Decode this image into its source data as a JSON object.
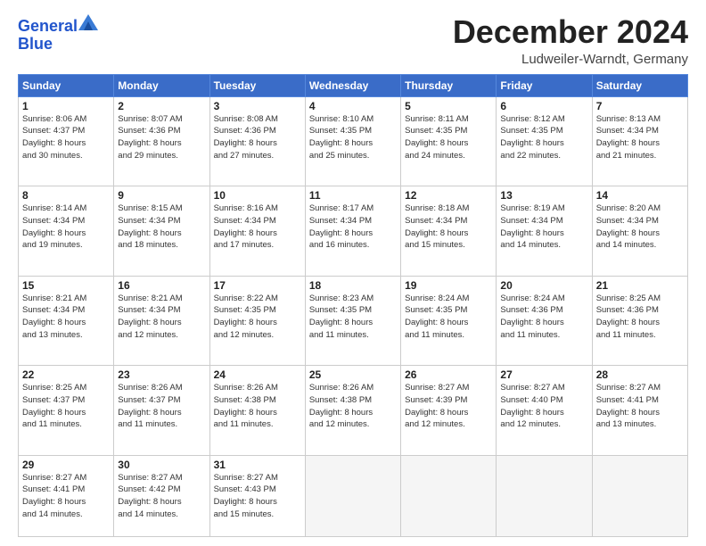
{
  "logo": {
    "line1": "General",
    "line2": "Blue"
  },
  "title": "December 2024",
  "location": "Ludweiler-Warndt, Germany",
  "headers": [
    "Sunday",
    "Monday",
    "Tuesday",
    "Wednesday",
    "Thursday",
    "Friday",
    "Saturday"
  ],
  "weeks": [
    [
      {
        "day": "1",
        "info": "Sunrise: 8:06 AM\nSunset: 4:37 PM\nDaylight: 8 hours\nand 30 minutes."
      },
      {
        "day": "2",
        "info": "Sunrise: 8:07 AM\nSunset: 4:36 PM\nDaylight: 8 hours\nand 29 minutes."
      },
      {
        "day": "3",
        "info": "Sunrise: 8:08 AM\nSunset: 4:36 PM\nDaylight: 8 hours\nand 27 minutes."
      },
      {
        "day": "4",
        "info": "Sunrise: 8:10 AM\nSunset: 4:35 PM\nDaylight: 8 hours\nand 25 minutes."
      },
      {
        "day": "5",
        "info": "Sunrise: 8:11 AM\nSunset: 4:35 PM\nDaylight: 8 hours\nand 24 minutes."
      },
      {
        "day": "6",
        "info": "Sunrise: 8:12 AM\nSunset: 4:35 PM\nDaylight: 8 hours\nand 22 minutes."
      },
      {
        "day": "7",
        "info": "Sunrise: 8:13 AM\nSunset: 4:34 PM\nDaylight: 8 hours\nand 21 minutes."
      }
    ],
    [
      {
        "day": "8",
        "info": "Sunrise: 8:14 AM\nSunset: 4:34 PM\nDaylight: 8 hours\nand 19 minutes."
      },
      {
        "day": "9",
        "info": "Sunrise: 8:15 AM\nSunset: 4:34 PM\nDaylight: 8 hours\nand 18 minutes."
      },
      {
        "day": "10",
        "info": "Sunrise: 8:16 AM\nSunset: 4:34 PM\nDaylight: 8 hours\nand 17 minutes."
      },
      {
        "day": "11",
        "info": "Sunrise: 8:17 AM\nSunset: 4:34 PM\nDaylight: 8 hours\nand 16 minutes."
      },
      {
        "day": "12",
        "info": "Sunrise: 8:18 AM\nSunset: 4:34 PM\nDaylight: 8 hours\nand 15 minutes."
      },
      {
        "day": "13",
        "info": "Sunrise: 8:19 AM\nSunset: 4:34 PM\nDaylight: 8 hours\nand 14 minutes."
      },
      {
        "day": "14",
        "info": "Sunrise: 8:20 AM\nSunset: 4:34 PM\nDaylight: 8 hours\nand 14 minutes."
      }
    ],
    [
      {
        "day": "15",
        "info": "Sunrise: 8:21 AM\nSunset: 4:34 PM\nDaylight: 8 hours\nand 13 minutes."
      },
      {
        "day": "16",
        "info": "Sunrise: 8:21 AM\nSunset: 4:34 PM\nDaylight: 8 hours\nand 12 minutes."
      },
      {
        "day": "17",
        "info": "Sunrise: 8:22 AM\nSunset: 4:35 PM\nDaylight: 8 hours\nand 12 minutes."
      },
      {
        "day": "18",
        "info": "Sunrise: 8:23 AM\nSunset: 4:35 PM\nDaylight: 8 hours\nand 11 minutes."
      },
      {
        "day": "19",
        "info": "Sunrise: 8:24 AM\nSunset: 4:35 PM\nDaylight: 8 hours\nand 11 minutes."
      },
      {
        "day": "20",
        "info": "Sunrise: 8:24 AM\nSunset: 4:36 PM\nDaylight: 8 hours\nand 11 minutes."
      },
      {
        "day": "21",
        "info": "Sunrise: 8:25 AM\nSunset: 4:36 PM\nDaylight: 8 hours\nand 11 minutes."
      }
    ],
    [
      {
        "day": "22",
        "info": "Sunrise: 8:25 AM\nSunset: 4:37 PM\nDaylight: 8 hours\nand 11 minutes."
      },
      {
        "day": "23",
        "info": "Sunrise: 8:26 AM\nSunset: 4:37 PM\nDaylight: 8 hours\nand 11 minutes."
      },
      {
        "day": "24",
        "info": "Sunrise: 8:26 AM\nSunset: 4:38 PM\nDaylight: 8 hours\nand 11 minutes."
      },
      {
        "day": "25",
        "info": "Sunrise: 8:26 AM\nSunset: 4:38 PM\nDaylight: 8 hours\nand 12 minutes."
      },
      {
        "day": "26",
        "info": "Sunrise: 8:27 AM\nSunset: 4:39 PM\nDaylight: 8 hours\nand 12 minutes."
      },
      {
        "day": "27",
        "info": "Sunrise: 8:27 AM\nSunset: 4:40 PM\nDaylight: 8 hours\nand 12 minutes."
      },
      {
        "day": "28",
        "info": "Sunrise: 8:27 AM\nSunset: 4:41 PM\nDaylight: 8 hours\nand 13 minutes."
      }
    ],
    [
      {
        "day": "29",
        "info": "Sunrise: 8:27 AM\nSunset: 4:41 PM\nDaylight: 8 hours\nand 14 minutes."
      },
      {
        "day": "30",
        "info": "Sunrise: 8:27 AM\nSunset: 4:42 PM\nDaylight: 8 hours\nand 14 minutes."
      },
      {
        "day": "31",
        "info": "Sunrise: 8:27 AM\nSunset: 4:43 PM\nDaylight: 8 hours\nand 15 minutes."
      },
      null,
      null,
      null,
      null
    ]
  ]
}
